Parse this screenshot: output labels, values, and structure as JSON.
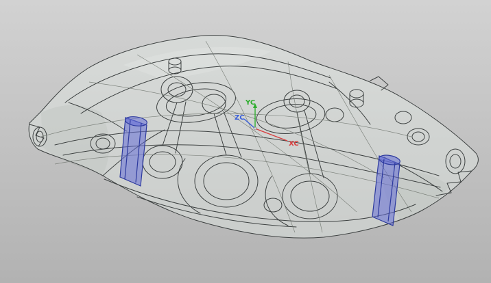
{
  "viewport": {
    "background": {
      "top": "#d2d2d2",
      "bottom": "#b2b2b2"
    },
    "model": {
      "label": "brake-caliper-wireframe",
      "body_fill": "rgba(226,233,228,0.45)",
      "edge_color": "#3c4040",
      "hidden_edge_color": "#70766f",
      "shade_fill": "rgba(148,154,150,0.30)",
      "highlight_fill": "rgba(255,255,255,0.20)"
    },
    "highlight": {
      "fill": "rgba(100,110,215,0.55)",
      "edge": "#2d3a9e"
    },
    "triad": {
      "labels": {
        "xc": "XC",
        "yc": "YC",
        "zc": "ZC"
      },
      "colors": {
        "xc": "#d84040",
        "yc": "#2fae2f",
        "zc": "#3a5fd9"
      }
    }
  }
}
